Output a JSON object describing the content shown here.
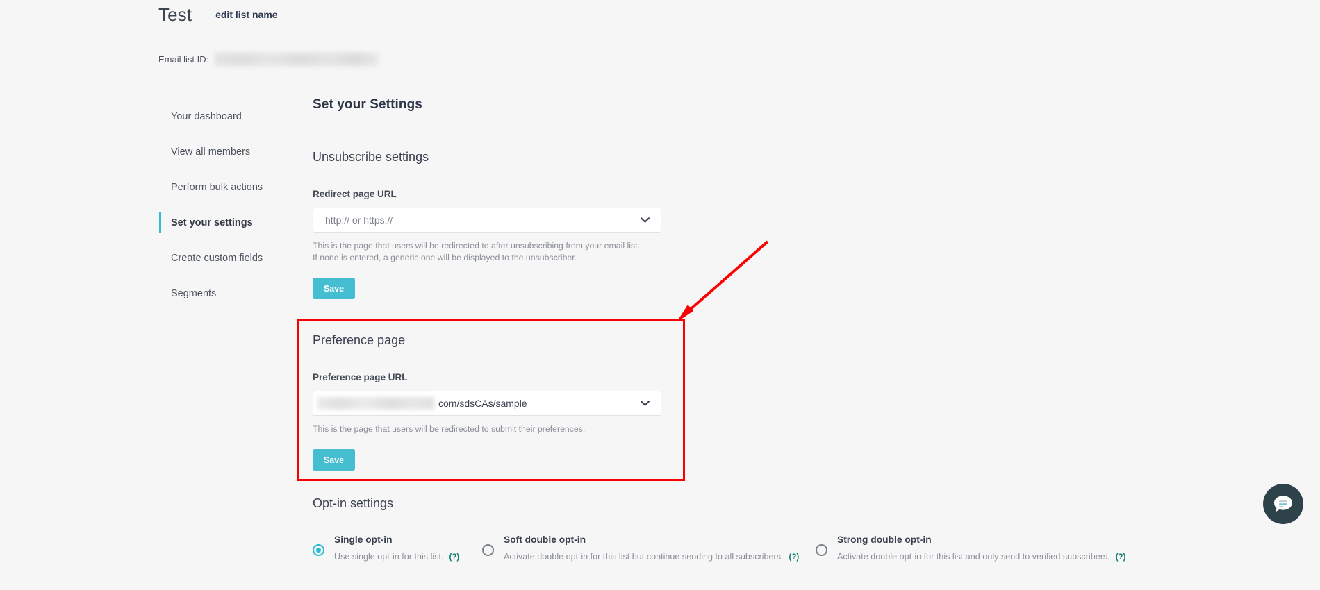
{
  "header": {
    "list_title": "Test",
    "edit_link": "edit list name",
    "list_id_label": "Email list ID:",
    "list_id_value": ""
  },
  "sidebar": {
    "items": [
      {
        "label": "Your dashboard",
        "active": false
      },
      {
        "label": "View all members",
        "active": false
      },
      {
        "label": "Perform bulk actions",
        "active": false
      },
      {
        "label": "Set your settings",
        "active": true
      },
      {
        "label": "Create custom fields",
        "active": false
      },
      {
        "label": "Segments",
        "active": false
      }
    ]
  },
  "main": {
    "page_heading": "Set your Settings",
    "unsubscribe": {
      "heading": "Unsubscribe settings",
      "field_label": "Redirect page URL",
      "input_placeholder": "http:// or https://",
      "input_value": "",
      "helper_text": "This is the page that users will be redirected to after unsubscribing from your email list. If none is entered, a generic one will be displayed to the unsubscriber.",
      "save_label": "Save"
    },
    "preference": {
      "heading": "Preference page",
      "field_label": "Preference page URL",
      "input_value": "com/sdsCAs/sample",
      "helper_text": "This is the page that users will be redirected to submit their preferences.",
      "save_label": "Save"
    },
    "optin": {
      "heading": "Opt-in settings",
      "options": [
        {
          "title": "Single opt-in",
          "description": "Use single opt-in for this list.",
          "help": "(?)",
          "selected": true
        },
        {
          "title": "Soft double opt-in",
          "description": "Activate double opt-in for this list but continue sending to all subscribers.",
          "help": "(?)",
          "selected": false
        },
        {
          "title": "Strong double opt-in",
          "description": "Activate double opt-in for this list and only send to verified subscribers.",
          "help": "(?)",
          "selected": false
        }
      ]
    }
  },
  "annotation": {
    "highlight_color": "#fa0000",
    "arrow_color": "#fa0000"
  },
  "colors": {
    "accent_teal": "#45bed2",
    "active_indicator": "#2ebfd0",
    "chat_bubble": "#2e4349",
    "help_badge": "#0c7a6e"
  },
  "chat": {
    "icon": "chat-bubble-icon"
  }
}
